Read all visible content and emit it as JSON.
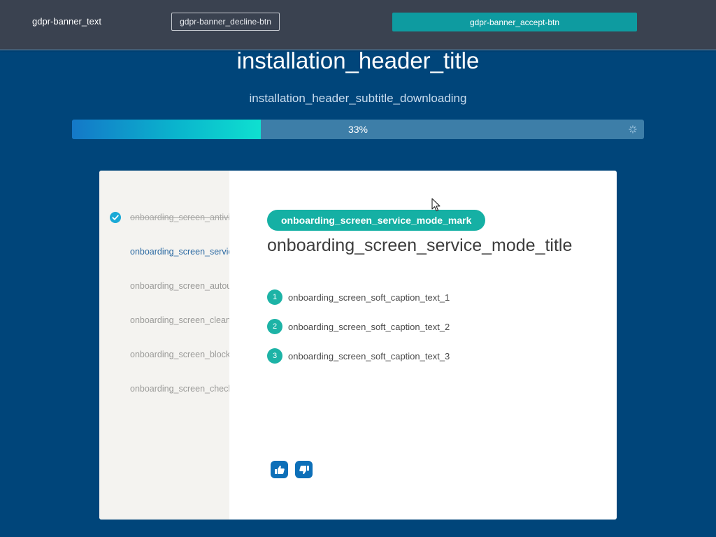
{
  "gdpr": {
    "text": "gdpr-banner_text",
    "decline_label": "gdpr-banner_decline-btn",
    "accept_label": "gdpr-banner_accept-btn"
  },
  "header": {
    "title": "installation_header_title",
    "subtitle": "installation_header_subtitle_downloading"
  },
  "progress": {
    "value": 0.33,
    "label": "33%",
    "icon": "spinner-icon"
  },
  "sidebar": {
    "items": [
      {
        "label": "onboarding_screen_antivirus",
        "state": "done"
      },
      {
        "label": "onboarding_screen_service",
        "state": "active"
      },
      {
        "label": "onboarding_screen_autoupdate",
        "state": "pending"
      },
      {
        "label": "onboarding_screen_cleanup",
        "state": "pending"
      },
      {
        "label": "onboarding_screen_block",
        "state": "pending"
      },
      {
        "label": "onboarding_screen_check",
        "state": "pending"
      }
    ]
  },
  "main": {
    "mark": "onboarding_screen_service_mode_mark",
    "title": "onboarding_screen_service_mode_title",
    "steps": [
      {
        "num": "1",
        "text": "onboarding_screen_soft_caption_text_1"
      },
      {
        "num": "2",
        "text": "onboarding_screen_soft_caption_text_2"
      },
      {
        "num": "3",
        "text": "onboarding_screen_soft_caption_text_3"
      }
    ],
    "feedback": {
      "like_icon": "thumbs-up-icon",
      "dislike_icon": "thumbs-down-icon"
    }
  },
  "colors": {
    "background": "#00457a",
    "banner": "#3a4250",
    "accent": "#15b0a4",
    "accept": "#0e9ba0",
    "active_link": "#2c6aa3"
  }
}
